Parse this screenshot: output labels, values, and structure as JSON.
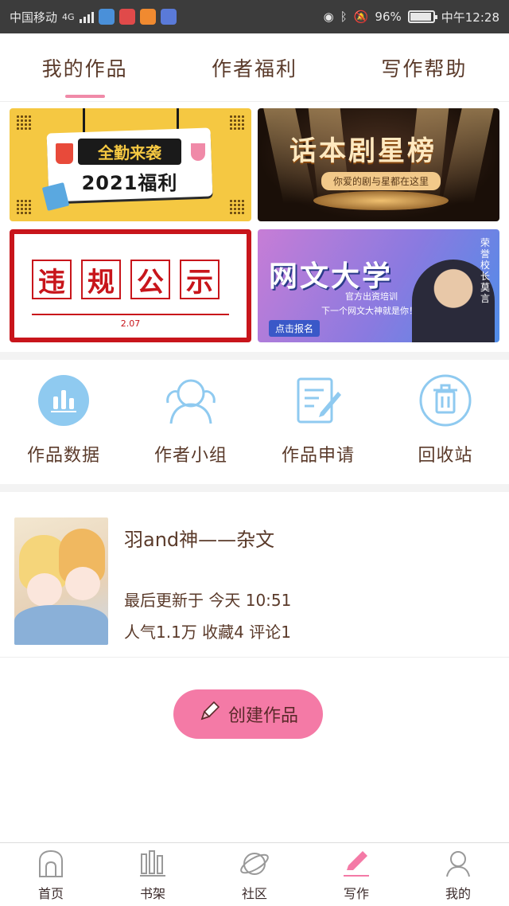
{
  "status_bar": {
    "carrier": "中国移动",
    "network": "4G",
    "battery": "96%",
    "time": "中午12:28"
  },
  "tabs": [
    {
      "label": "我的作品",
      "active": true
    },
    {
      "label": "作者福利",
      "active": false
    },
    {
      "label": "写作帮助",
      "active": false
    }
  ],
  "banners": {
    "b1": {
      "line1": "全勤来袭",
      "line2": "2021福利"
    },
    "b2": {
      "title": "话本剧星榜",
      "subtitle": "你爱的剧与星都在这里"
    },
    "b3": {
      "chars": [
        "违",
        "规",
        "公",
        "示"
      ],
      "date": "2.07"
    },
    "b4": {
      "title": "网文大学",
      "sub1": "官方出资培训",
      "sub2": "下一个网文大神就是你！",
      "button": "点击报名",
      "tag": "荣誉校长莫言"
    }
  },
  "functions": [
    {
      "label": "作品数据",
      "icon": "bar-chart-icon"
    },
    {
      "label": "作者小组",
      "icon": "group-person-icon"
    },
    {
      "label": "作品申请",
      "icon": "edit-document-icon"
    },
    {
      "label": "回收站",
      "icon": "trash-icon"
    }
  ],
  "work": {
    "title": "羽and神——杂文",
    "updated": "最后更新于 今天 10:51",
    "stats": "人气1.1万 收藏4 评论1"
  },
  "create_button": {
    "label": "创建作品"
  },
  "bottom_nav": [
    {
      "label": "首页",
      "icon": "home-icon",
      "active": false
    },
    {
      "label": "书架",
      "icon": "bookshelf-icon",
      "active": false
    },
    {
      "label": "社区",
      "icon": "planet-icon",
      "active": false
    },
    {
      "label": "写作",
      "icon": "pen-icon",
      "active": true
    },
    {
      "label": "我的",
      "icon": "profile-icon",
      "active": false
    }
  ],
  "colors": {
    "accent_pink": "#f47aa6",
    "tab_underline": "#f08aa8",
    "icon_blue": "#6fb8e8",
    "text_brown": "#5a3a2a"
  }
}
